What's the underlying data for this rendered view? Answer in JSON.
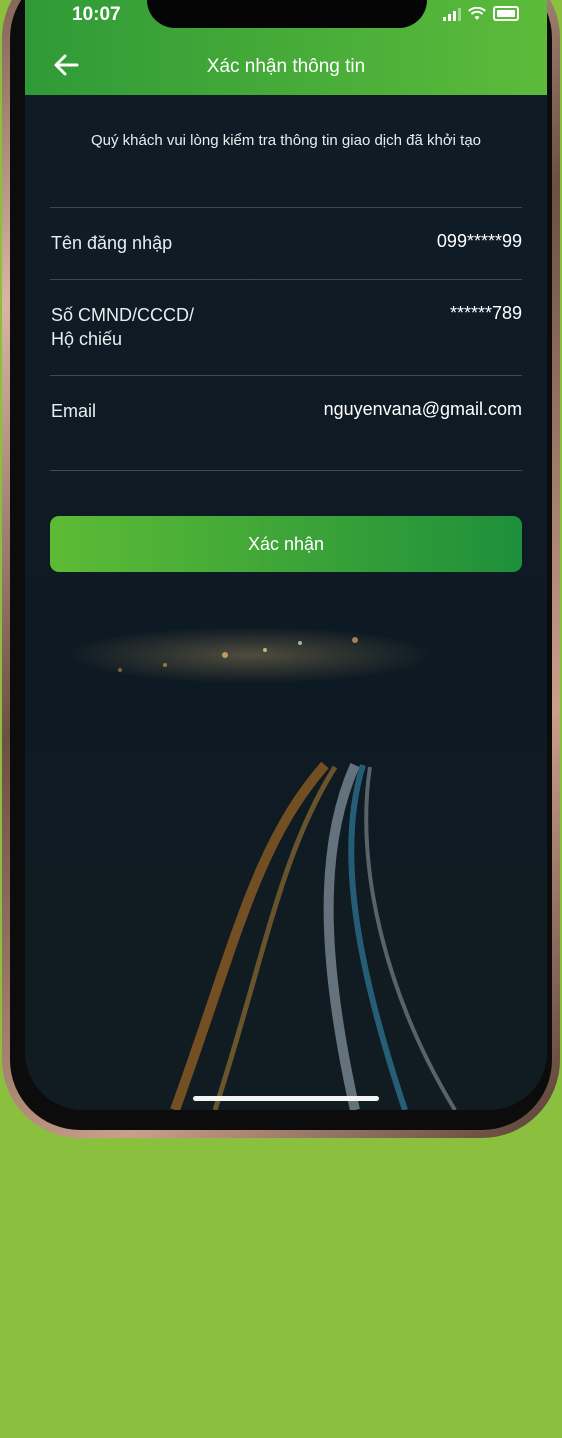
{
  "status_bar": {
    "time": "10:07"
  },
  "header": {
    "title": "Xác nhận thông tin"
  },
  "intro_text": "Quý khách vui lòng kiểm tra thông tin giao dịch đã khởi tạo",
  "fields": [
    {
      "label": "Tên đăng nhập",
      "value": "099*****99"
    },
    {
      "label": "Số CMND/CCCD/\nHộ chiếu",
      "value": "******789"
    },
    {
      "label": "Email",
      "value": "nguyenvana@gmail.com"
    }
  ],
  "confirm_button": {
    "label": "Xác nhận"
  },
  "colors": {
    "header_green": "#4db13a",
    "page_background": "#8bc03f",
    "screen_dark": "#0f1b24"
  },
  "icons": [
    "back-arrow-icon",
    "signal-icon",
    "wifi-icon",
    "battery-icon"
  ]
}
